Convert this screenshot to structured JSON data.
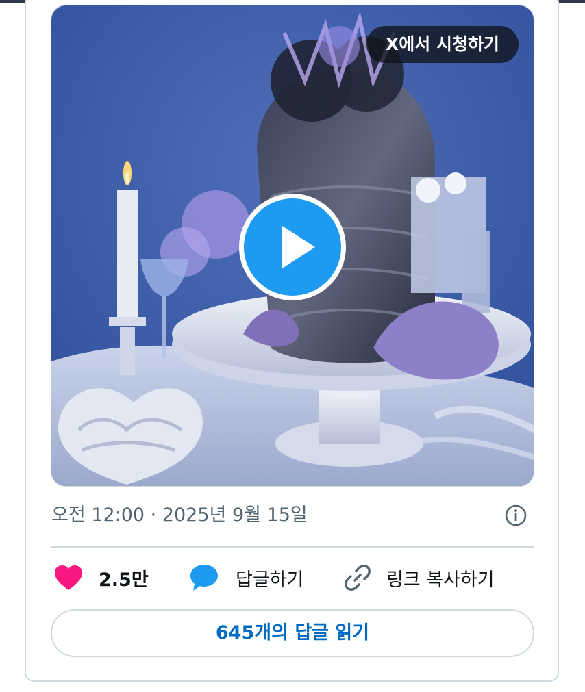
{
  "media": {
    "watch_on_x_label": "X에서 시청하기",
    "play_icon": "play-icon"
  },
  "meta": {
    "timestamp": "오전 12:00 · 2025년 9월 15일",
    "info_icon": "info-icon"
  },
  "actions": {
    "like_count": "2.5만",
    "reply_label": "답글하기",
    "copy_link_label": "링크 복사하기"
  },
  "read_replies_label": "645개의 답글 읽기",
  "colors": {
    "like": "#f91880",
    "reply": "#1d9bf0",
    "link_text": "#0069c2",
    "play": "#1d9bf0"
  }
}
